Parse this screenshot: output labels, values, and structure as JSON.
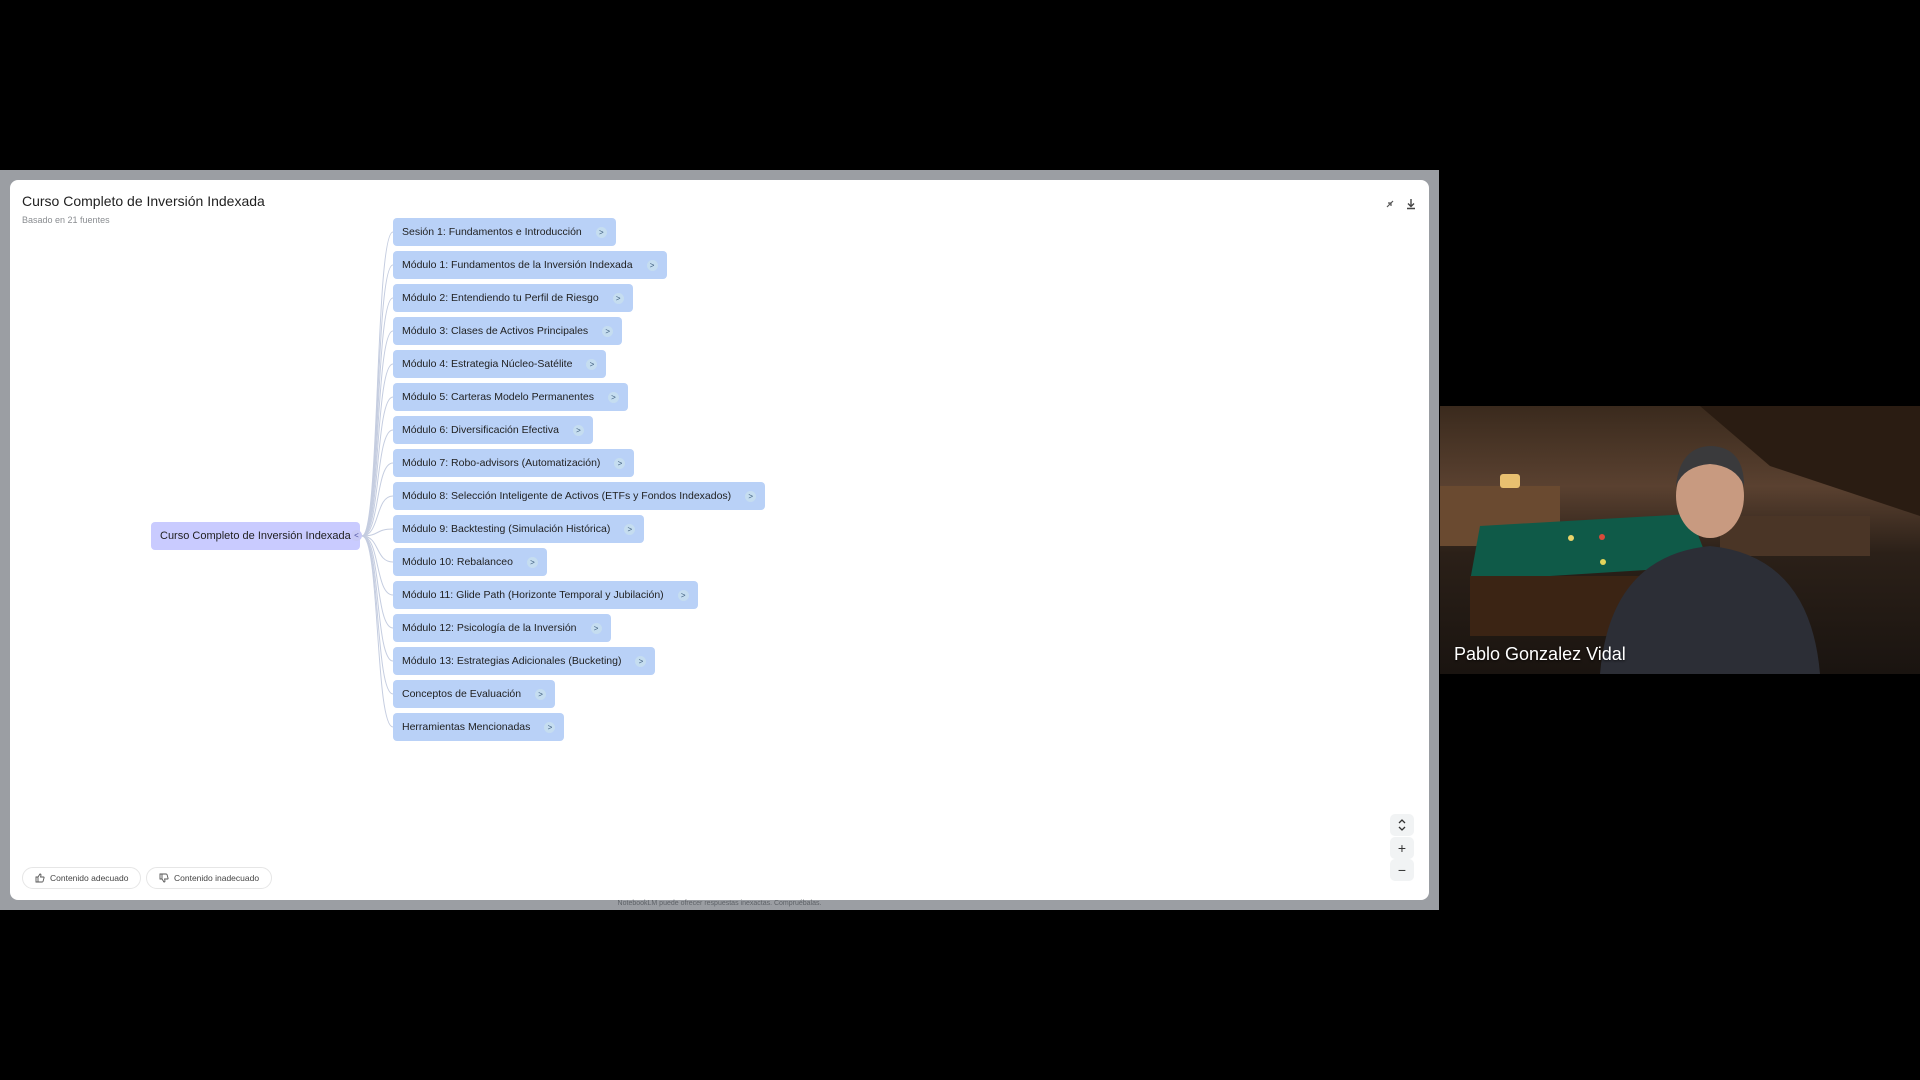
{
  "mindmap": {
    "title": "Curso Completo de Inversión Indexada",
    "subtitle": "Basado en 21 fuentes",
    "root_label": "Curso Completo de Inversión Indexada",
    "expand_glyph": ">",
    "collapse_glyph": "<",
    "nodes": [
      "Sesión 1: Fundamentos e Introducción",
      "Módulo 1: Fundamentos de la Inversión Indexada",
      "Módulo 2: Entendiendo tu Perfil de Riesgo",
      "Módulo 3: Clases de Activos Principales",
      "Módulo 4: Estrategia Núcleo-Satélite",
      "Módulo 5: Carteras Modelo Permanentes",
      "Módulo 6: Diversificación Efectiva",
      "Módulo 7: Robo-advisors (Automatización)",
      "Módulo 8: Selección Inteligente de Activos (ETFs y Fondos Indexados)",
      "Módulo 9: Backtesting (Simulación Histórica)",
      "Módulo 10: Rebalanceo",
      "Módulo 11: Glide Path (Horizonte Temporal y Jubilación)",
      "Módulo 12: Psicología de la Inversión",
      "Módulo 13: Estrategias Adicionales (Bucketing)",
      "Conceptos de Evaluación",
      "Herramientas Mencionadas"
    ]
  },
  "feedback": {
    "good_label": "Contenido adecuado",
    "bad_label": "Contenido inadecuado"
  },
  "controls": {
    "zoom_in": "+",
    "zoom_out": "−"
  },
  "disclaimer": "NotebookLM puede ofrecer respuestas inexactas. Compruébalas.",
  "speaker": {
    "name": "Pablo Gonzalez Vidal"
  },
  "colors": {
    "root_node": "#c9cbff",
    "child_node": "#b9d1f7",
    "edge": "#c5cde0"
  }
}
